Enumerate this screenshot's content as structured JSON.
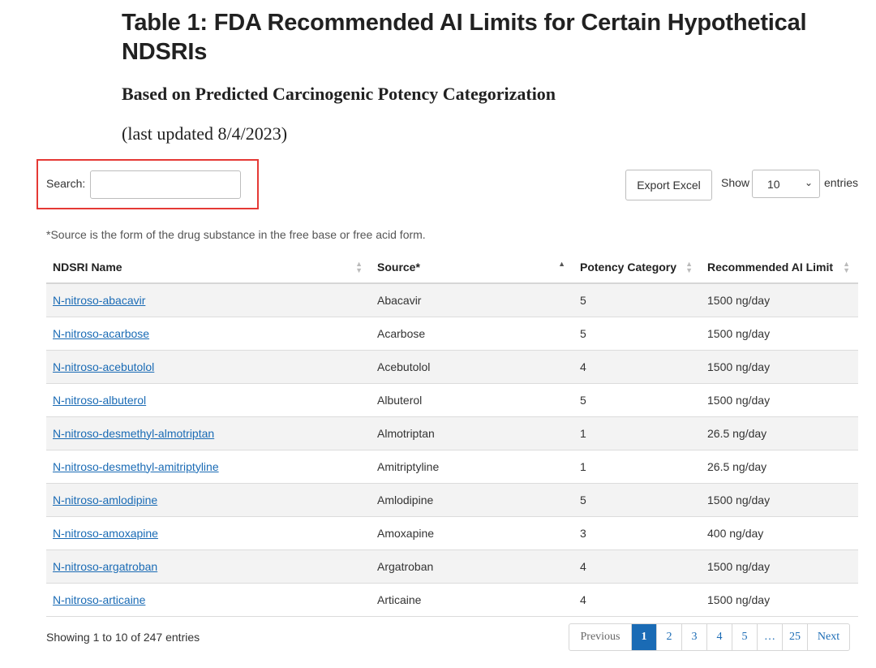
{
  "header": {
    "title": "Table 1: FDA Recommended AI Limits for Certain Hypothetical NDSRIs",
    "subtitle": "Based on Predicted Carcinogenic Potency Categorization",
    "updated": "(last updated 8/4/2023)"
  },
  "controls": {
    "search_label": "Search:",
    "search_value": "",
    "export_label": "Export Excel",
    "show_label": "Show",
    "show_value": "10",
    "entries_label": "entries",
    "highlight_color": "#e53935"
  },
  "note": "*Source is the form of the drug substance in the free base or free acid form.",
  "table": {
    "columns": [
      "NDSRI Name",
      "Source*",
      "Potency Category",
      "Recommended AI Limit"
    ],
    "rows": [
      {
        "name": "N-nitroso-abacavir",
        "source": "Abacavir",
        "category": "5",
        "limit": "1500 ng/day"
      },
      {
        "name": "N-nitroso-acarbose",
        "source": "Acarbose",
        "category": "5",
        "limit": "1500 ng/day"
      },
      {
        "name": "N-nitroso-acebutolol",
        "source": "Acebutolol",
        "category": "4",
        "limit": "1500 ng/day"
      },
      {
        "name": "N-nitroso-albuterol",
        "source": "Albuterol",
        "category": "5",
        "limit": "1500 ng/day"
      },
      {
        "name": "N-nitroso-desmethyl-almotriptan",
        "source": "Almotriptan",
        "category": "1",
        "limit": "26.5 ng/day"
      },
      {
        "name": "N-nitroso-desmethyl-amitriptyline",
        "source": "Amitriptyline",
        "category": "1",
        "limit": "26.5 ng/day"
      },
      {
        "name": "N-nitroso-amlodipine",
        "source": "Amlodipine",
        "category": "5",
        "limit": "1500 ng/day"
      },
      {
        "name": "N-nitroso-amoxapine",
        "source": "Amoxapine",
        "category": "3",
        "limit": "400 ng/day"
      },
      {
        "name": "N-nitroso-argatroban",
        "source": "Argatroban",
        "category": "4",
        "limit": "1500 ng/day"
      },
      {
        "name": "N-nitroso-articaine",
        "source": "Articaine",
        "category": "4",
        "limit": "1500 ng/day"
      }
    ]
  },
  "footer": {
    "info": "Showing 1 to 10 of 247 entries",
    "pagination": [
      "Previous",
      "1",
      "2",
      "3",
      "4",
      "5",
      "…",
      "25",
      "Next"
    ],
    "active_page": "1"
  }
}
